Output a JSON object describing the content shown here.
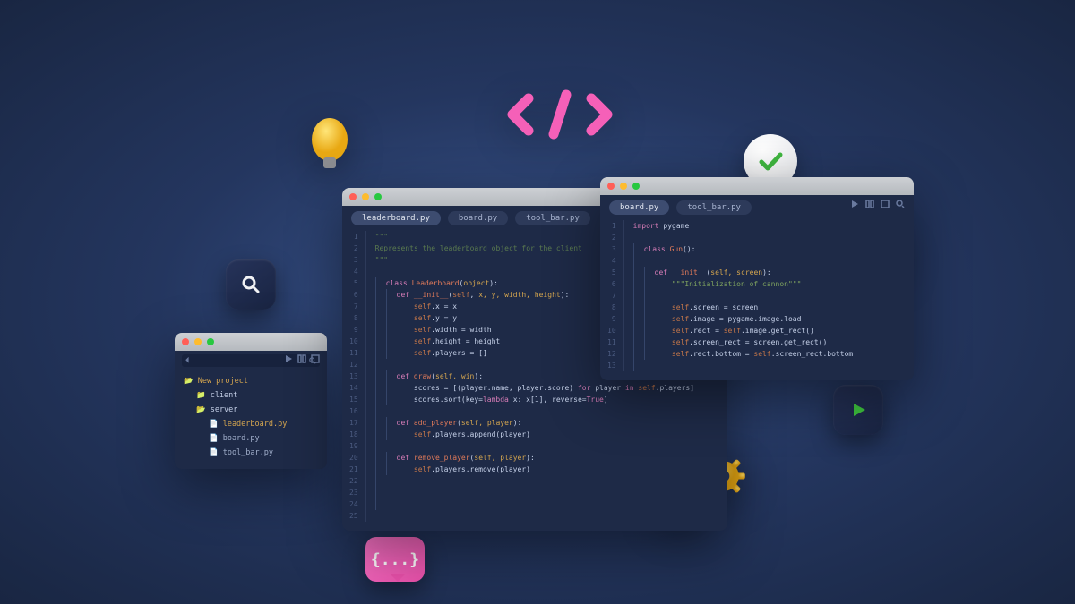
{
  "explorer": {
    "project": "New project",
    "folders": [
      "client",
      "server"
    ],
    "files": [
      "leaderboard.py",
      "board.py",
      "tool_bar.py"
    ]
  },
  "main_editor": {
    "tabs": [
      "leaderboard.py",
      "board.py",
      "tool_bar.py"
    ],
    "active_tab": 0,
    "line_start": 1,
    "line_end": 25,
    "code": {
      "l1": "\"\"\"",
      "l2": "Represents the leaderboard object for the client",
      "l3": "\"\"\"",
      "l5_kw": "class",
      "l5_name": "Leaderboard",
      "l5_par": "object",
      "l6_kw": "def",
      "l6_fn": "__init__",
      "l6_self": "self",
      "l6_args": "x, y, width, height",
      "l7": "self.x = x",
      "l8": "self.y = y",
      "l9": "self.width = width",
      "l10": "self.height = height",
      "l11": "self.players = []",
      "l13_kw": "def",
      "l13_fn": "draw",
      "l13_args": "self, win",
      "l14_a": "scores = [(player.name, player.score)",
      "l14_kw": "for",
      "l14_b": "player",
      "l14_kw2": "in",
      "l14_c": "self.players]",
      "l15_a": "scores.sort(key=",
      "l15_kw": "lambda",
      "l15_b": "x: x[1], reverse=",
      "l15_kw2": "True",
      "l15_c": ")",
      "l17_kw": "def",
      "l17_fn": "add_player",
      "l17_args": "self, player",
      "l18": "self.players.append(player)",
      "l20_kw": "def",
      "l20_fn": "remove_player",
      "l20_args": "self, player",
      "l21": "self.players.remove(player)"
    }
  },
  "right_editor": {
    "tabs": [
      "board.py",
      "tool_bar.py"
    ],
    "active_tab": 0,
    "line_start": 1,
    "line_end": 13,
    "code": {
      "l1_kw": "import",
      "l1_mod": "pygame",
      "l3_kw": "class",
      "l3_name": "Gun",
      "l3_par": "",
      "l5_kw": "def",
      "l5_fn": "__init__",
      "l5_args": "self, screen",
      "l6": "\"\"\"Initialization of cannon\"\"\"",
      "l8": "self.screen = screen",
      "l9": "self.image = pygame.image.load",
      "l10": "self.rect = self.image.get_rect()",
      "l11": "self.screen_rect = screen.get_rect()",
      "l12": "self.rect.bottom = self.screen_rect.bottom"
    }
  },
  "deco": {
    "brackets_text": "{...}"
  },
  "colors": {
    "accent": "#d87db8"
  }
}
